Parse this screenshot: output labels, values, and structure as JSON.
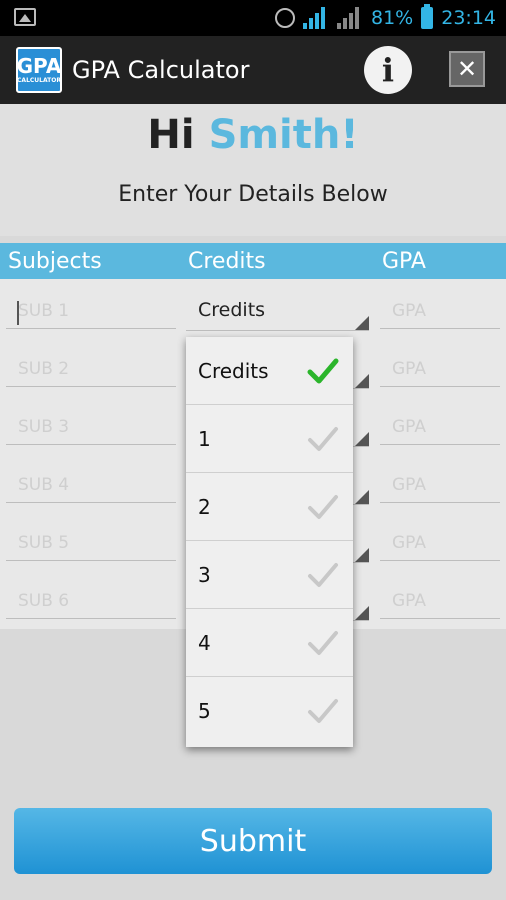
{
  "status_bar": {
    "battery": "81%",
    "time": "23:14"
  },
  "action_bar": {
    "logo_text": "GPA",
    "logo_sub": "CALCULATOR",
    "title": "GPA Calculator",
    "info_glyph": "i",
    "close_glyph": "✕"
  },
  "greeting": {
    "hi": "Hi",
    "name": "Smith!",
    "instructions": "Enter Your Details Below"
  },
  "table": {
    "headers": [
      "Subjects",
      "Credits",
      "GPA"
    ],
    "rows": [
      {
        "subject_placeholder": "SUB 1",
        "gpa_placeholder": "GPA"
      },
      {
        "subject_placeholder": "SUB 2",
        "gpa_placeholder": "GPA"
      },
      {
        "subject_placeholder": "SUB 3",
        "gpa_placeholder": "GPA"
      },
      {
        "subject_placeholder": "SUB 4",
        "gpa_placeholder": "GPA"
      },
      {
        "subject_placeholder": "SUB 5",
        "gpa_placeholder": "GPA"
      },
      {
        "subject_placeholder": "SUB 6",
        "gpa_placeholder": "GPA"
      }
    ],
    "spinner_value": "Credits"
  },
  "dropdown": {
    "options": [
      "Credits",
      "1",
      "2",
      "3",
      "4",
      "5"
    ],
    "selected": "Credits"
  },
  "submit_label": "Submit",
  "colors": {
    "accent": "#5bb8de",
    "check_selected": "#2bb52b",
    "check_unselected": "#c8c8c8"
  }
}
